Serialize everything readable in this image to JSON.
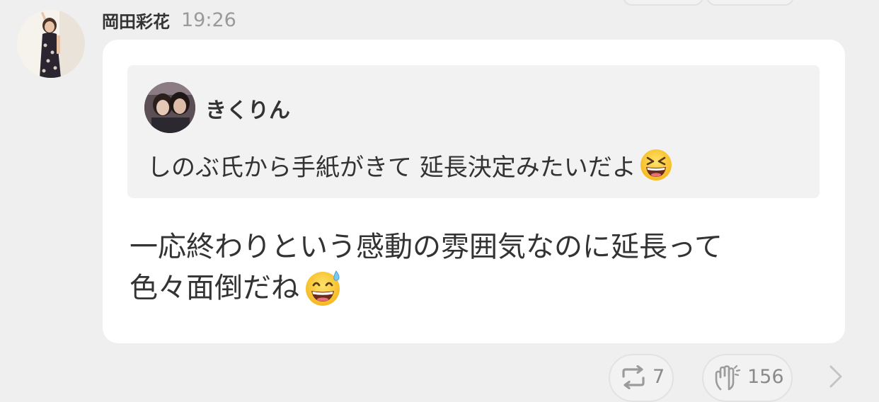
{
  "post": {
    "author": "岡田彩花",
    "time": "19:26",
    "quote": {
      "author": "きくりん",
      "text": "しのぶ氏から手紙がきて 延長決定みたいだよ",
      "emoji": "grinning-squinting-face"
    },
    "message": {
      "line1": "一応終わりという感動の雰囲気なのに延長って",
      "line2": "色々面倒だね",
      "emoji": "grinning-face-with-sweat"
    }
  },
  "actions": {
    "retweet_count": "7",
    "clap_count": "156"
  },
  "icons": {
    "retweet": "retweet-icon",
    "clap": "clap-icon",
    "next": "chevron-right-icon"
  },
  "colors": {
    "background": "#efefef",
    "bubble": "#ffffff",
    "quote_background": "#f2f2f2",
    "muted_text": "#9a9a9a",
    "icon_gray": "#9b9b9b"
  }
}
